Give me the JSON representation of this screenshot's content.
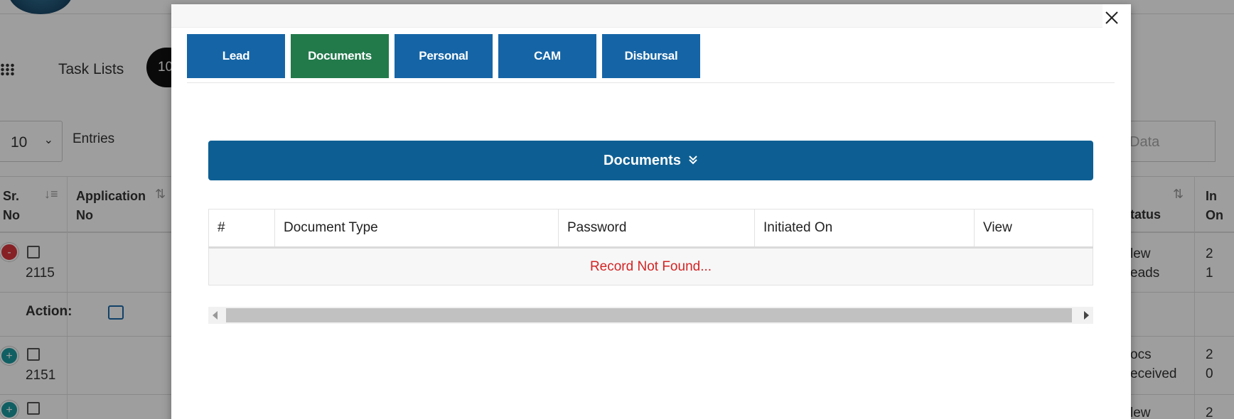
{
  "background": {
    "tasklists_label": "Task Lists",
    "count_badge": "10",
    "entries_select_value": "10",
    "entries_label": "Entries",
    "search_placeholder": "Data",
    "columns": {
      "sr_no": "Sr.\nNo",
      "application_no": "Application\nNo",
      "status": "tatus",
      "initiated": "In\nOn"
    },
    "rows": [
      {
        "toggle": "-",
        "number": "2115",
        "status": "lew\neads",
        "initiated": "2\n1"
      },
      {
        "toggle": "+",
        "number": "2151",
        "status": "ocs\neceived",
        "initiated": "2\n0"
      },
      {
        "toggle": "+",
        "number": "",
        "status": "lew",
        "initiated": "2"
      }
    ],
    "action_label": "Action:"
  },
  "modal": {
    "tabs": [
      {
        "label": "Lead",
        "active": false
      },
      {
        "label": "Documents",
        "active": true
      },
      {
        "label": "Personal",
        "active": false
      },
      {
        "label": "CAM",
        "active": false
      },
      {
        "label": "Disbursal",
        "active": false
      }
    ],
    "section_title": "Documents",
    "table": {
      "headers": [
        "#",
        "Document Type",
        "Password",
        "Initiated On",
        "View"
      ],
      "empty_message": "Record Not Found..."
    }
  },
  "colors": {
    "tab_blue": "#1565a6",
    "tab_active_green": "#227a4b",
    "section_bar": "#0d5f93",
    "empty_message_red": "#d42424"
  }
}
